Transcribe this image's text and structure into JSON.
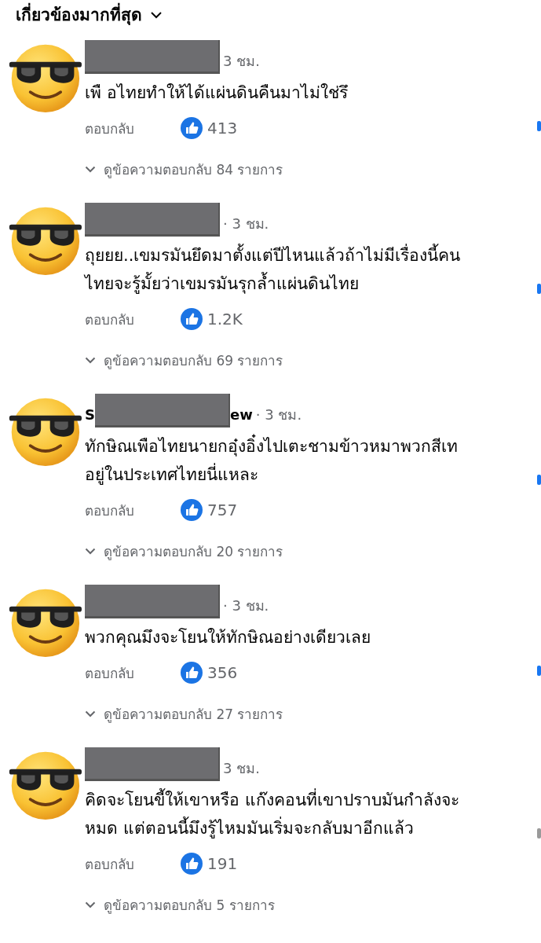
{
  "sort_menu": {
    "label": "เกี่ยวข้องมากที่สุด"
  },
  "comments": [
    {
      "time": "3 ชม.",
      "lines": [
        "เพื อไทยทำให้ได้แผ่นดินคืนมาไม่ใช่รึ"
      ],
      "reply_label": "ตอบกลับ",
      "likes": "413",
      "replies_link": "ดูข้อความตอบกลับ 84 รายการ",
      "color": "#1877f2"
    },
    {
      "time": "· 3 ชม.",
      "lines": [
        "ถุยยย..เขมรมันยึดมาตั้งแต่ปีไหนแล้วถ้าไม่มีเรื่องนี้คน",
        "ไทยจะรู้มั้ยว่าเขมรมันรุกล้ำแผ่นดินไทย"
      ],
      "reply_label": "ตอบกลับ",
      "likes": "1.2K",
      "replies_link": "ดูข้อความตอบกลับ 69 รายการ",
      "color": "#1877f2"
    },
    {
      "author_fragments": [
        "S",
        "ew"
      ],
      "time": "· 3 ชม.",
      "lines": [
        "ทักษิณเพือไทยนายกอุ๋งอิ๋งไปเตะชามข้าวหมาพวกสีเท",
        "อยู่ในประเทศไทยนี่แหละ"
      ],
      "reply_label": "ตอบกลับ",
      "likes": "757",
      "replies_link": "ดูข้อความตอบกลับ 20 รายการ",
      "color": "#1877f2"
    },
    {
      "time": "· 3 ชม.",
      "lines": [
        "พวกคุณมึงจะโยนให้ทักษิณอย่างเดียวเลย"
      ],
      "reply_label": "ตอบกลับ",
      "likes": "356",
      "replies_link": "ดูข้อความตอบกลับ 27 รายการ",
      "color": "#1877f2"
    },
    {
      "time": "3 ชม.",
      "lines": [
        "คิดจะโยนขี้ให้เขาหรือ แก๊งคอนที่เขาปราบมันกำลังจะ",
        "หมด แต่ตอนนี้มึงรู้ไหมมันเริ่มจะกลับมาอีกแล้ว"
      ],
      "reply_label": "ตอบกลับ",
      "likes": "191",
      "replies_link": "ดูข้อความตอบกลับ 5 รายการ",
      "color": "#9a9a9a"
    }
  ]
}
